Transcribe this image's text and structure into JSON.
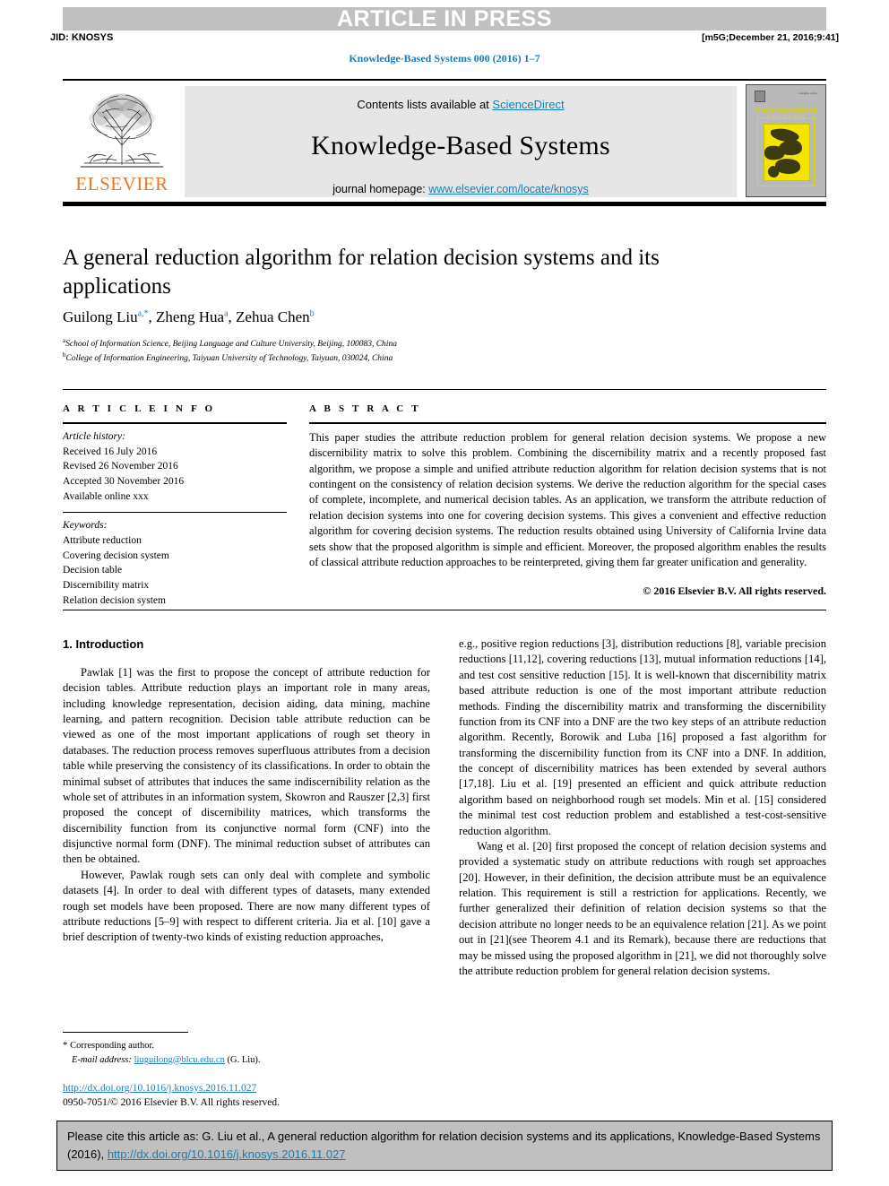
{
  "banner": {
    "press_label": "ARTICLE IN PRESS"
  },
  "running_head": {
    "jid": "JID: KNOSYS",
    "stamp": "[m5G;December 21, 2016;9:41]",
    "journal_ref": "Knowledge-Based Systems 000 (2016) 1–7"
  },
  "masthead": {
    "publisher": "ELSEVIER",
    "contents_prefix": "Contents lists available at ",
    "contents_link": "ScienceDirect",
    "journal_title": "Knowledge-Based Systems",
    "homepage_prefix": "journal homepage: ",
    "homepage_link": "www.elsevier.com/locate/knosys",
    "cover": {
      "line1": "Knowledge-Based",
      "line2": "SYSTEMS",
      "top_note": "Available online"
    }
  },
  "article": {
    "title": "A general reduction algorithm for relation decision systems and its applications",
    "authors_parts": [
      {
        "name": "Guilong Liu",
        "sup": "a,*"
      },
      {
        "name": "Zheng Hua",
        "sup": "a"
      },
      {
        "name": "Zehua Chen",
        "sup": "b"
      }
    ],
    "affiliations": [
      {
        "marker": "a",
        "text": "School of Information Science, Beijing Language and Culture University, Beijing, 100083, China"
      },
      {
        "marker": "b",
        "text": "College of Information Engineering, Taiyuan University of Technology, Taiyuan, 030024, China"
      }
    ]
  },
  "info": {
    "heading": "A R T I C L E     I N F O",
    "history_label": "Article history:",
    "history": [
      "Received 16 July 2016",
      "Revised 26 November 2016",
      "Accepted 30 November 2016",
      "Available online xxx"
    ],
    "keywords_label": "Keywords:",
    "keywords": [
      "Attribute reduction",
      "Covering decision system",
      "Decision table",
      "Discernibility matrix",
      "Relation decision system"
    ]
  },
  "abstract": {
    "heading": "A B S T R A C T",
    "text": "This paper studies the attribute reduction problem for general relation decision systems. We propose a new discernibility matrix to solve this problem. Combining the discernibility matrix and a recently proposed fast algorithm, we propose a simple and unified attribute reduction algorithm for relation decision systems that is not contingent on the consistency of relation decision systems. We derive the reduction algorithm for the special cases of complete, incomplete, and numerical decision tables. As an application, we transform the attribute reduction of relation decision systems into one for covering decision systems. This gives a convenient and effective reduction algorithm for covering decision systems. The reduction results obtained using University of California Irvine data sets show that the proposed algorithm is simple and efficient. Moreover, the proposed algorithm enables the results of classical attribute reduction approaches to be reinterpreted, giving them far greater unification and generality.",
    "copyright": "© 2016 Elsevier B.V. All rights reserved."
  },
  "body": {
    "section_heading": "1. Introduction",
    "left_paragraphs": [
      "Pawlak [1] was the first to propose the concept of attribute reduction for decision tables. Attribute reduction plays an important role in many areas, including knowledge representation, decision aiding, data mining, machine learning, and pattern recognition. Decision table attribute reduction can be viewed as one of the most important applications of rough set theory in databases. The reduction process removes superfluous attributes from a decision table while preserving the consistency of its classifications. In order to obtain the minimal subset of attributes that induces the same indiscernibility relation as the whole set of attributes in an information system, Skowron and Rauszer [2,3] first proposed the concept of discernibility matrices, which transforms the discernibility function from its conjunctive normal form (CNF) into the disjunctive normal form (DNF). The minimal reduction subset of attributes can then be obtained.",
      "However, Pawlak rough sets can only deal with complete and symbolic datasets [4]. In order to deal with different types of datasets, many extended rough set models have been proposed. There are now many different types of attribute reductions [5–9] with respect to different criteria. Jia et al. [10] gave a brief description of twenty-two kinds of existing reduction approaches,"
    ],
    "right_paragraphs": [
      "e.g., positive region reductions [3], distribution reductions [8], variable precision reductions [11,12], covering reductions [13], mutual information reductions [14], and test cost sensitive reduction [15]. It is well-known that discernibility matrix based attribute reduction is one of the most important attribute reduction methods. Finding the discernibility matrix and transforming the discernibility function from its CNF into a DNF are the two key steps of an attribute reduction algorithm. Recently, Borowik and Luba [16] proposed a fast algorithm for transforming the discernibility function from its CNF into a DNF. In addition, the concept of discernibility matrices has been extended by several authors [17,18]. Liu et al. [19] presented an efficient and quick attribute reduction algorithm based on neighborhood rough set models. Min et al. [15] considered the minimal test cost reduction problem and established a test-cost-sensitive reduction algorithm.",
      "Wang et al. [20] first proposed the concept of relation decision systems and provided a systematic study on attribute reductions with rough set approaches [20]. However, in their definition, the decision attribute must be an equivalence relation. This requirement is still a restriction for applications. Recently, we further generalized their definition of relation decision systems so that the decision attribute no longer needs to be an equivalence relation [21]. As we point out in [21](see Theorem 4.1 and its Remark), because there are reductions that may be missed using the proposed algorithm in [21], we did not thoroughly solve the attribute reduction problem for general relation decision systems."
    ]
  },
  "footnotes": {
    "corresponding": "Corresponding author.",
    "email_label": "E-mail address:",
    "email": "liuguilong@blcu.edu.cn",
    "email_owner": "(G. Liu).",
    "doi_url": "http://dx.doi.org/10.1016/j.knosys.2016.11.027",
    "issn_line": "0950-7051/© 2016 Elsevier B.V. All rights reserved."
  },
  "citation_box": {
    "prefix": "Please cite this article as: G. Liu et al., A general reduction algorithm for relation decision systems and its applications, Knowledge-Based Systems (2016), ",
    "link": "http://dx.doi.org/10.1016/j.knosys.2016.11.027"
  },
  "colors": {
    "link": "#1a7db6",
    "banner_bg": "#c0c0c0",
    "elsevier_orange": "#e87722",
    "panel_bg": "#e6e6e6",
    "cover_yellow": "#f2e500"
  }
}
